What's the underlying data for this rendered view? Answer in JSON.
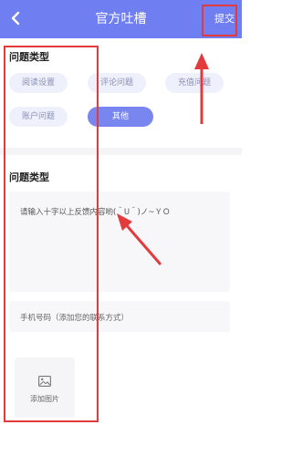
{
  "header": {
    "title": "官方吐槽",
    "submit_label": "提交",
    "background": "#6f7ef0"
  },
  "issue_types": {
    "title": "问题类型",
    "options": [
      "阅读设置",
      "评论问题",
      "充值问题",
      "账户问题",
      "其他"
    ],
    "selected": "其他"
  },
  "feedback": {
    "title": "问题类型",
    "placeholder": "请输入十字以上反馈内容哟(＾U＾)ノ~ＹＯ",
    "phone_placeholder": "手机号码（添加您的联系方式）"
  },
  "attachment": {
    "add_image_label": "添加图片"
  },
  "annotation": {
    "color": "#e33b3b"
  }
}
